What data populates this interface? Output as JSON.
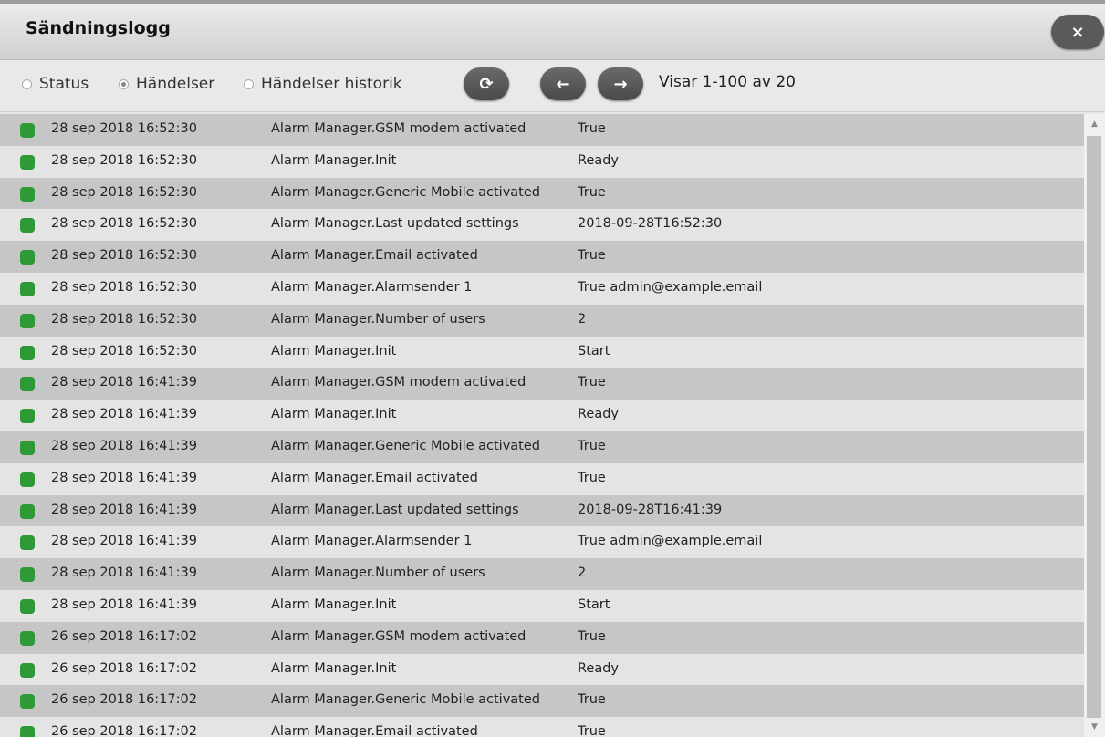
{
  "dialog": {
    "title": "Sändningslogg",
    "close_icon": "×"
  },
  "toolbar": {
    "radios": [
      {
        "label": "Status",
        "checked": false
      },
      {
        "label": "Händelser",
        "checked": true
      },
      {
        "label": "Händelser historik",
        "checked": false
      }
    ],
    "refresh_icon": "⟳",
    "prev_icon": "←",
    "next_icon": "→",
    "pager_text": "Visar 1-100 av 20"
  },
  "colors": {
    "status_ok": "#2e9a35",
    "row_dark": "#c6c6c6",
    "row_light": "#e4e4e4"
  },
  "rows": [
    {
      "date": "28 sep 2018 16:52:30",
      "event": "Alarm Manager.GSM modem activated",
      "value": "True"
    },
    {
      "date": "28 sep 2018 16:52:30",
      "event": "Alarm Manager.Init",
      "value": "Ready"
    },
    {
      "date": "28 sep 2018 16:52:30",
      "event": "Alarm Manager.Generic Mobile activated",
      "value": "True"
    },
    {
      "date": "28 sep 2018 16:52:30",
      "event": "Alarm Manager.Last updated settings",
      "value": "2018-09-28T16:52:30"
    },
    {
      "date": "28 sep 2018 16:52:30",
      "event": "Alarm Manager.Email activated",
      "value": "True"
    },
    {
      "date": "28 sep 2018 16:52:30",
      "event": "Alarm Manager.Alarmsender 1",
      "value": "True admin@example.email"
    },
    {
      "date": "28 sep 2018 16:52:30",
      "event": "Alarm Manager.Number of users",
      "value": "2"
    },
    {
      "date": "28 sep 2018 16:52:30",
      "event": "Alarm Manager.Init",
      "value": "Start"
    },
    {
      "date": "28 sep 2018 16:41:39",
      "event": "Alarm Manager.GSM modem activated",
      "value": "True"
    },
    {
      "date": "28 sep 2018 16:41:39",
      "event": "Alarm Manager.Init",
      "value": "Ready"
    },
    {
      "date": "28 sep 2018 16:41:39",
      "event": "Alarm Manager.Generic Mobile activated",
      "value": "True"
    },
    {
      "date": "28 sep 2018 16:41:39",
      "event": "Alarm Manager.Email activated",
      "value": "True"
    },
    {
      "date": "28 sep 2018 16:41:39",
      "event": "Alarm Manager.Last updated settings",
      "value": "2018-09-28T16:41:39"
    },
    {
      "date": "28 sep 2018 16:41:39",
      "event": "Alarm Manager.Alarmsender 1",
      "value": "True admin@example.email"
    },
    {
      "date": "28 sep 2018 16:41:39",
      "event": "Alarm Manager.Number of users",
      "value": "2"
    },
    {
      "date": "28 sep 2018 16:41:39",
      "event": "Alarm Manager.Init",
      "value": "Start"
    },
    {
      "date": "26 sep 2018 16:17:02",
      "event": "Alarm Manager.GSM modem activated",
      "value": "True"
    },
    {
      "date": "26 sep 2018 16:17:02",
      "event": "Alarm Manager.Init",
      "value": "Ready"
    },
    {
      "date": "26 sep 2018 16:17:02",
      "event": "Alarm Manager.Generic Mobile activated",
      "value": "True"
    },
    {
      "date": "26 sep 2018 16:17:02",
      "event": "Alarm Manager.Email activated",
      "value": "True"
    }
  ]
}
